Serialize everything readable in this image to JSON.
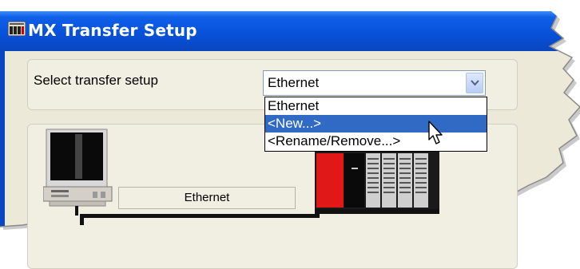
{
  "window": {
    "title": "MX Transfer Setup",
    "title_bar_color": "#0a54e3",
    "body_color": "#ece9d8"
  },
  "transfer_setup": {
    "label": "Select transfer setup",
    "selected_value": "Ethernet",
    "options": [
      "Ethernet",
      "<New...>",
      "<Rename/Remove...>"
    ],
    "highlighted_option": "<New...>",
    "highlight_color": "#316ac5"
  },
  "connection": {
    "label": "Ethernet"
  },
  "icons": {
    "app": "app-icon",
    "computer": "computer-icon",
    "plc": "plc-icon",
    "cursor": "mouse-pointer-icon",
    "dropdown_arrow": "chevron-down-icon"
  }
}
